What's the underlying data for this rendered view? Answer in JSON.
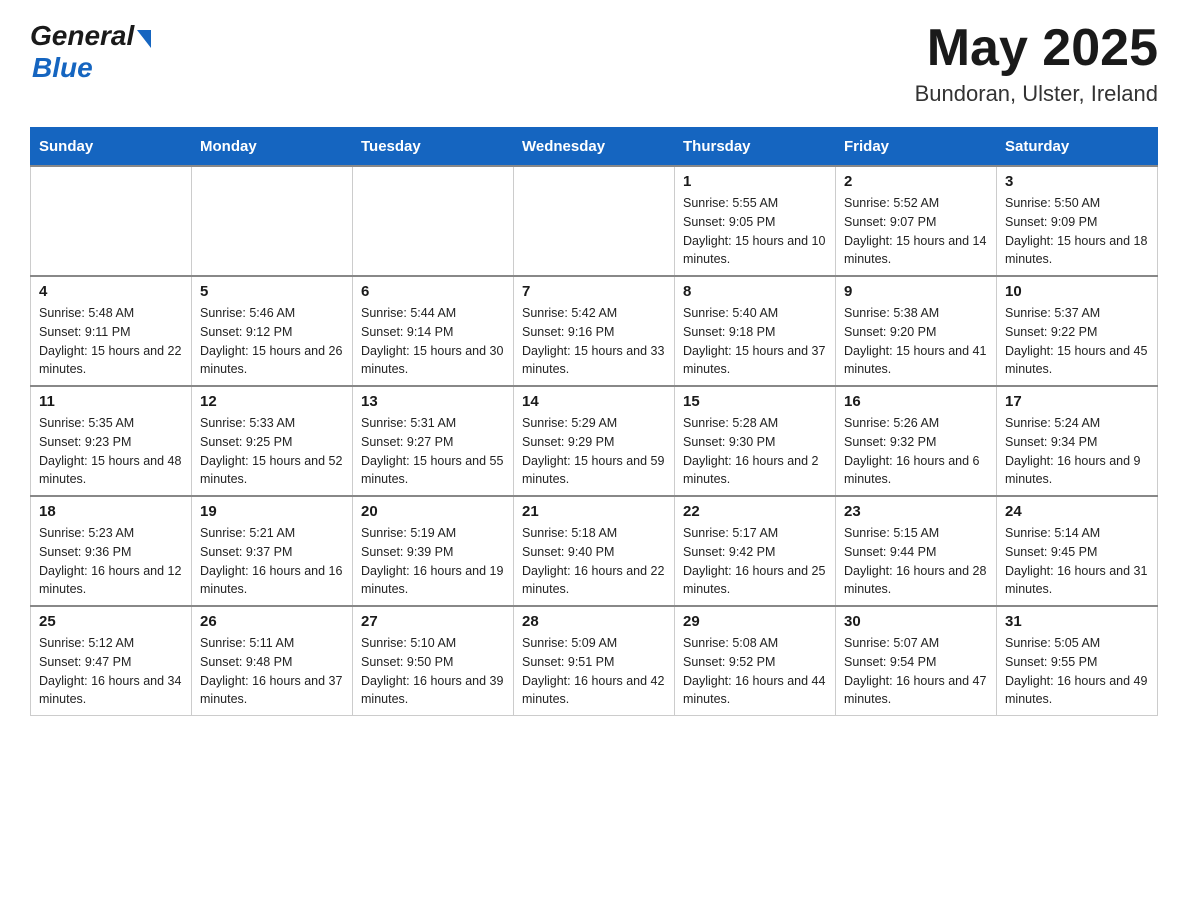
{
  "header": {
    "logo_general": "General",
    "logo_blue": "Blue",
    "month_year": "May 2025",
    "location": "Bundoran, Ulster, Ireland"
  },
  "days_of_week": [
    "Sunday",
    "Monday",
    "Tuesday",
    "Wednesday",
    "Thursday",
    "Friday",
    "Saturday"
  ],
  "weeks": [
    [
      {
        "day": "",
        "sunrise": "",
        "sunset": "",
        "daylight": ""
      },
      {
        "day": "",
        "sunrise": "",
        "sunset": "",
        "daylight": ""
      },
      {
        "day": "",
        "sunrise": "",
        "sunset": "",
        "daylight": ""
      },
      {
        "day": "",
        "sunrise": "",
        "sunset": "",
        "daylight": ""
      },
      {
        "day": "1",
        "sunrise": "Sunrise: 5:55 AM",
        "sunset": "Sunset: 9:05 PM",
        "daylight": "Daylight: 15 hours and 10 minutes."
      },
      {
        "day": "2",
        "sunrise": "Sunrise: 5:52 AM",
        "sunset": "Sunset: 9:07 PM",
        "daylight": "Daylight: 15 hours and 14 minutes."
      },
      {
        "day": "3",
        "sunrise": "Sunrise: 5:50 AM",
        "sunset": "Sunset: 9:09 PM",
        "daylight": "Daylight: 15 hours and 18 minutes."
      }
    ],
    [
      {
        "day": "4",
        "sunrise": "Sunrise: 5:48 AM",
        "sunset": "Sunset: 9:11 PM",
        "daylight": "Daylight: 15 hours and 22 minutes."
      },
      {
        "day": "5",
        "sunrise": "Sunrise: 5:46 AM",
        "sunset": "Sunset: 9:12 PM",
        "daylight": "Daylight: 15 hours and 26 minutes."
      },
      {
        "day": "6",
        "sunrise": "Sunrise: 5:44 AM",
        "sunset": "Sunset: 9:14 PM",
        "daylight": "Daylight: 15 hours and 30 minutes."
      },
      {
        "day": "7",
        "sunrise": "Sunrise: 5:42 AM",
        "sunset": "Sunset: 9:16 PM",
        "daylight": "Daylight: 15 hours and 33 minutes."
      },
      {
        "day": "8",
        "sunrise": "Sunrise: 5:40 AM",
        "sunset": "Sunset: 9:18 PM",
        "daylight": "Daylight: 15 hours and 37 minutes."
      },
      {
        "day": "9",
        "sunrise": "Sunrise: 5:38 AM",
        "sunset": "Sunset: 9:20 PM",
        "daylight": "Daylight: 15 hours and 41 minutes."
      },
      {
        "day": "10",
        "sunrise": "Sunrise: 5:37 AM",
        "sunset": "Sunset: 9:22 PM",
        "daylight": "Daylight: 15 hours and 45 minutes."
      }
    ],
    [
      {
        "day": "11",
        "sunrise": "Sunrise: 5:35 AM",
        "sunset": "Sunset: 9:23 PM",
        "daylight": "Daylight: 15 hours and 48 minutes."
      },
      {
        "day": "12",
        "sunrise": "Sunrise: 5:33 AM",
        "sunset": "Sunset: 9:25 PM",
        "daylight": "Daylight: 15 hours and 52 minutes."
      },
      {
        "day": "13",
        "sunrise": "Sunrise: 5:31 AM",
        "sunset": "Sunset: 9:27 PM",
        "daylight": "Daylight: 15 hours and 55 minutes."
      },
      {
        "day": "14",
        "sunrise": "Sunrise: 5:29 AM",
        "sunset": "Sunset: 9:29 PM",
        "daylight": "Daylight: 15 hours and 59 minutes."
      },
      {
        "day": "15",
        "sunrise": "Sunrise: 5:28 AM",
        "sunset": "Sunset: 9:30 PM",
        "daylight": "Daylight: 16 hours and 2 minutes."
      },
      {
        "day": "16",
        "sunrise": "Sunrise: 5:26 AM",
        "sunset": "Sunset: 9:32 PM",
        "daylight": "Daylight: 16 hours and 6 minutes."
      },
      {
        "day": "17",
        "sunrise": "Sunrise: 5:24 AM",
        "sunset": "Sunset: 9:34 PM",
        "daylight": "Daylight: 16 hours and 9 minutes."
      }
    ],
    [
      {
        "day": "18",
        "sunrise": "Sunrise: 5:23 AM",
        "sunset": "Sunset: 9:36 PM",
        "daylight": "Daylight: 16 hours and 12 minutes."
      },
      {
        "day": "19",
        "sunrise": "Sunrise: 5:21 AM",
        "sunset": "Sunset: 9:37 PM",
        "daylight": "Daylight: 16 hours and 16 minutes."
      },
      {
        "day": "20",
        "sunrise": "Sunrise: 5:19 AM",
        "sunset": "Sunset: 9:39 PM",
        "daylight": "Daylight: 16 hours and 19 minutes."
      },
      {
        "day": "21",
        "sunrise": "Sunrise: 5:18 AM",
        "sunset": "Sunset: 9:40 PM",
        "daylight": "Daylight: 16 hours and 22 minutes."
      },
      {
        "day": "22",
        "sunrise": "Sunrise: 5:17 AM",
        "sunset": "Sunset: 9:42 PM",
        "daylight": "Daylight: 16 hours and 25 minutes."
      },
      {
        "day": "23",
        "sunrise": "Sunrise: 5:15 AM",
        "sunset": "Sunset: 9:44 PM",
        "daylight": "Daylight: 16 hours and 28 minutes."
      },
      {
        "day": "24",
        "sunrise": "Sunrise: 5:14 AM",
        "sunset": "Sunset: 9:45 PM",
        "daylight": "Daylight: 16 hours and 31 minutes."
      }
    ],
    [
      {
        "day": "25",
        "sunrise": "Sunrise: 5:12 AM",
        "sunset": "Sunset: 9:47 PM",
        "daylight": "Daylight: 16 hours and 34 minutes."
      },
      {
        "day": "26",
        "sunrise": "Sunrise: 5:11 AM",
        "sunset": "Sunset: 9:48 PM",
        "daylight": "Daylight: 16 hours and 37 minutes."
      },
      {
        "day": "27",
        "sunrise": "Sunrise: 5:10 AM",
        "sunset": "Sunset: 9:50 PM",
        "daylight": "Daylight: 16 hours and 39 minutes."
      },
      {
        "day": "28",
        "sunrise": "Sunrise: 5:09 AM",
        "sunset": "Sunset: 9:51 PM",
        "daylight": "Daylight: 16 hours and 42 minutes."
      },
      {
        "day": "29",
        "sunrise": "Sunrise: 5:08 AM",
        "sunset": "Sunset: 9:52 PM",
        "daylight": "Daylight: 16 hours and 44 minutes."
      },
      {
        "day": "30",
        "sunrise": "Sunrise: 5:07 AM",
        "sunset": "Sunset: 9:54 PM",
        "daylight": "Daylight: 16 hours and 47 minutes."
      },
      {
        "day": "31",
        "sunrise": "Sunrise: 5:05 AM",
        "sunset": "Sunset: 9:55 PM",
        "daylight": "Daylight: 16 hours and 49 minutes."
      }
    ]
  ]
}
